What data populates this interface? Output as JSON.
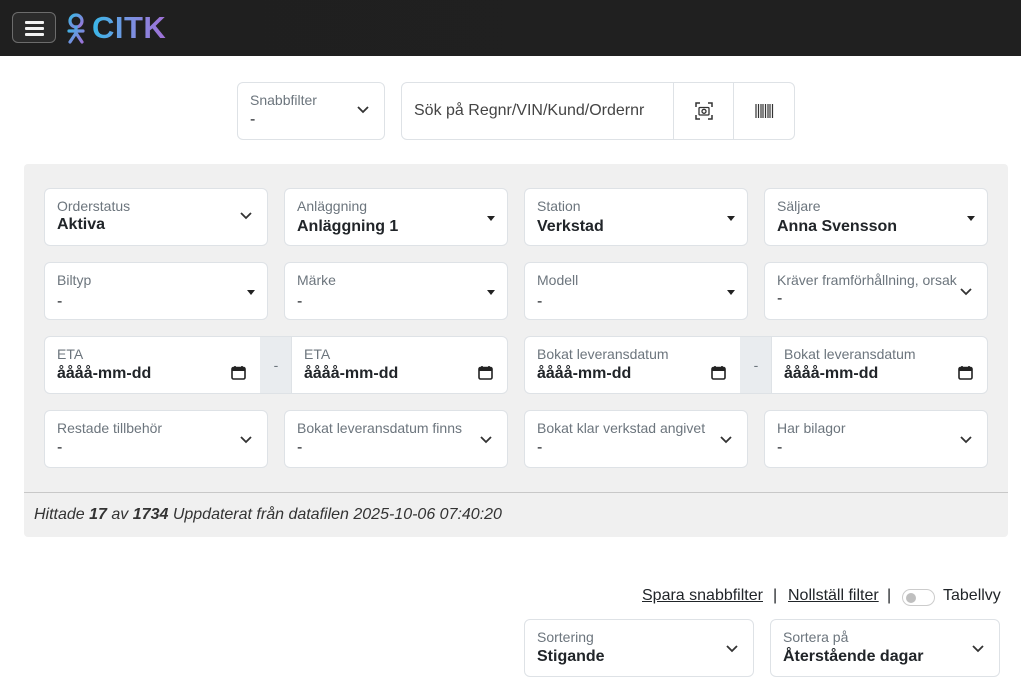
{
  "header": {
    "logo_text": "CITK",
    "menu_icon": "hamburger-icon"
  },
  "search": {
    "quickfilter_label": "Snabbfilter",
    "quickfilter_value": "-",
    "search_placeholder": "Sök på Regnr/VIN/Kund/Ordernr"
  },
  "filters": {
    "orderstatus": {
      "label": "Orderstatus",
      "value": "Aktiva"
    },
    "anlaggning": {
      "label": "Anläggning",
      "value": "Anläggning 1"
    },
    "station": {
      "label": "Station",
      "value": "Verkstad"
    },
    "saljare": {
      "label": "Säljare",
      "value": "Anna Svensson"
    },
    "biltyp": {
      "label": "Biltyp",
      "value": "-"
    },
    "marke": {
      "label": "Märke",
      "value": "-"
    },
    "modell": {
      "label": "Modell",
      "value": "-"
    },
    "framforhallning": {
      "label": "Kräver framförhållning, orsak",
      "value": "-"
    },
    "eta_from": {
      "label": "ETA",
      "value": "åååå-mm-dd"
    },
    "eta_to": {
      "label": "ETA",
      "value": "åååå-mm-dd"
    },
    "leverans_from": {
      "label": "Bokat leveransdatum",
      "value": "åååå-mm-dd"
    },
    "leverans_to": {
      "label": "Bokat leveransdatum",
      "value": "åååå-mm-dd"
    },
    "restade": {
      "label": "Restade tillbehör",
      "value": "-"
    },
    "leverans_finns": {
      "label": "Bokat leveransdatum finns",
      "value": "-"
    },
    "klar_verkstad": {
      "label": "Bokat klar verkstad angivet",
      "value": "-"
    },
    "bilagor": {
      "label": "Har bilagor",
      "value": "-"
    },
    "range_separator": "-"
  },
  "result": {
    "prefix": "Hittade",
    "found": "17",
    "of": "av",
    "total": "1734",
    "updated": "Uppdaterat från datafilen 2025-10-06 07:40:20"
  },
  "actions": {
    "save_quickfilter": "Spara snabbfilter",
    "separator": "|",
    "reset_filter": "Nollställ filter",
    "table_view": "Tabellvy"
  },
  "sorting": {
    "order_label": "Sortering",
    "order_value": "Stigande",
    "sortby_label": "Sortera på",
    "sortby_value": "Återstående dagar"
  }
}
